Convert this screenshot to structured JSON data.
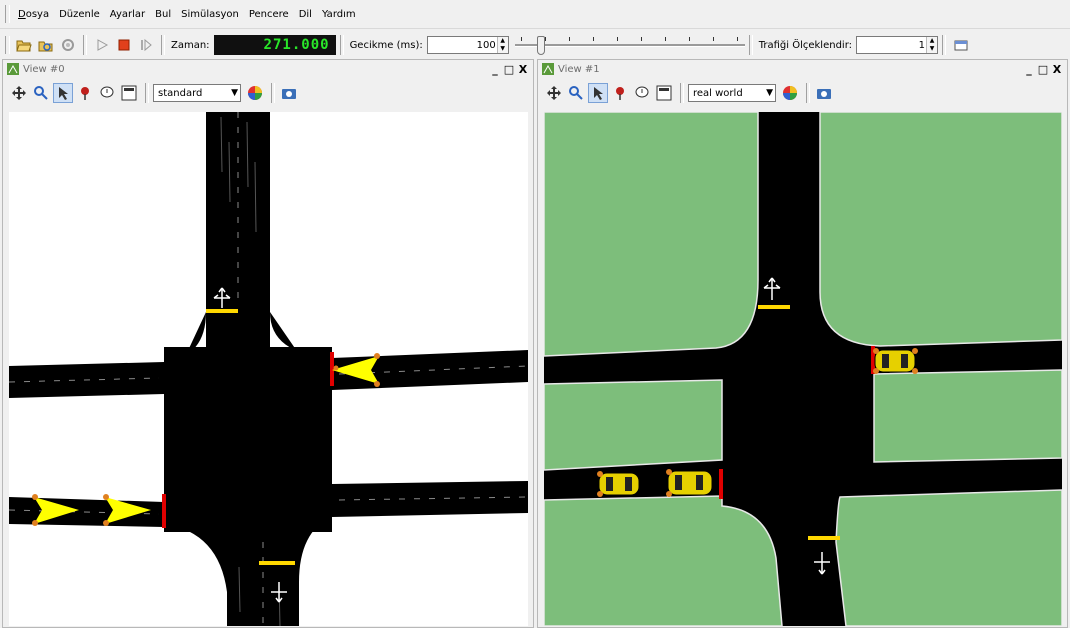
{
  "menu": {
    "items": [
      "Dosya",
      "Düzenle",
      "Ayarlar",
      "Bul",
      "Simülasyon",
      "Pencere",
      "Dil",
      "Yardım"
    ]
  },
  "toolbar": {
    "time_label": "Zaman:",
    "time_value": "271.000",
    "delay_label": "Gecikme (ms):",
    "delay_value": "100",
    "scale_label": "Trafiği Ölçeklendir:",
    "scale_value": "1"
  },
  "views": [
    {
      "title": "View #0",
      "scheme": "standard"
    },
    {
      "title": "View #1",
      "scheme": "real world"
    }
  ],
  "window_controls": {
    "minimize": "_",
    "restore": "□",
    "close": "X"
  },
  "icons": {
    "open": "open-folder-icon",
    "reload": "reload-icon",
    "run": "play-icon",
    "stop": "stop-icon",
    "step": "step-icon",
    "locate": "locate-icon",
    "colors": "color-wheel-icon",
    "screenshot": "camera-icon"
  },
  "colors": {
    "road": "#000000",
    "lawn": "#7dbe7b",
    "vehicle_standard": "#ffff00",
    "vehicle_realworld": "#e6d000",
    "stop_red": "#e00000",
    "stop_yellow": "#ffd800",
    "time_green": "#29e629"
  }
}
